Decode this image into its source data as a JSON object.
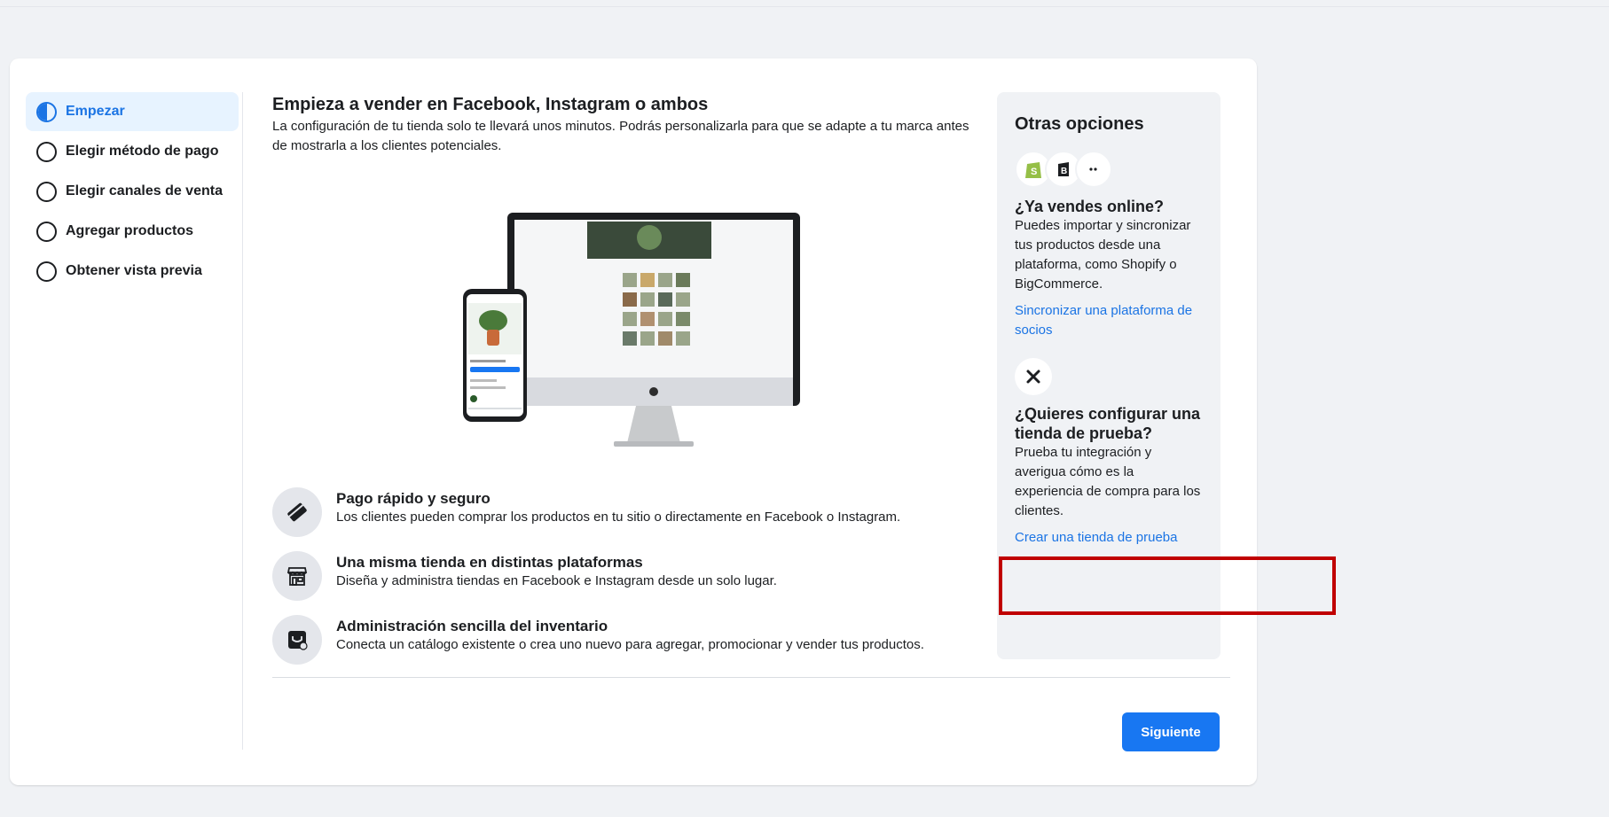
{
  "steps": [
    {
      "label": "Empezar",
      "active": true
    },
    {
      "label": "Elegir método de pago",
      "active": false
    },
    {
      "label": "Elegir canales de venta",
      "active": false
    },
    {
      "label": "Agregar productos",
      "active": false
    },
    {
      "label": "Obtener vista previa",
      "active": false
    }
  ],
  "main": {
    "title": "Empieza a vender en Facebook, Instagram o ambos",
    "intro": "La configuración de tu tienda solo te llevará unos minutos. Podrás personalizarla para que se adapte a tu marca antes de mostrarla a los clientes potenciales."
  },
  "features": [
    {
      "icon": "credit-card-icon",
      "title": "Pago rápido y seguro",
      "desc": "Los clientes pueden comprar los productos en tu sitio o directamente en Facebook o Instagram."
    },
    {
      "icon": "storefront-icon",
      "title": "Una misma tienda en distintas plataformas",
      "desc": "Diseña y administra tiendas en Facebook e Instagram desde un solo lugar."
    },
    {
      "icon": "inventory-icon",
      "title": "Administración sencilla del inventario",
      "desc": "Conecta un catálogo existente o crea uno nuevo para agregar, promocionar y vender tus productos."
    }
  ],
  "side": {
    "title": "Otras opciones",
    "sync": {
      "heading": "¿Ya vendes online?",
      "desc": "Puedes importar y sincronizar tus productos desde una plataforma, como Shopify o BigCommerce.",
      "link": "Sincronizar una plataforma de socios"
    },
    "test": {
      "heading": "¿Quieres configurar una tienda de prueba?",
      "desc": "Prueba tu integración y averigua cómo es la experiencia de compra para los clientes.",
      "link": "Crear una tienda de prueba"
    }
  },
  "buttons": {
    "next": "Siguiente"
  },
  "colors": {
    "accent": "#1877f2",
    "highlight": "#c00000",
    "panel": "#f0f2f5"
  }
}
